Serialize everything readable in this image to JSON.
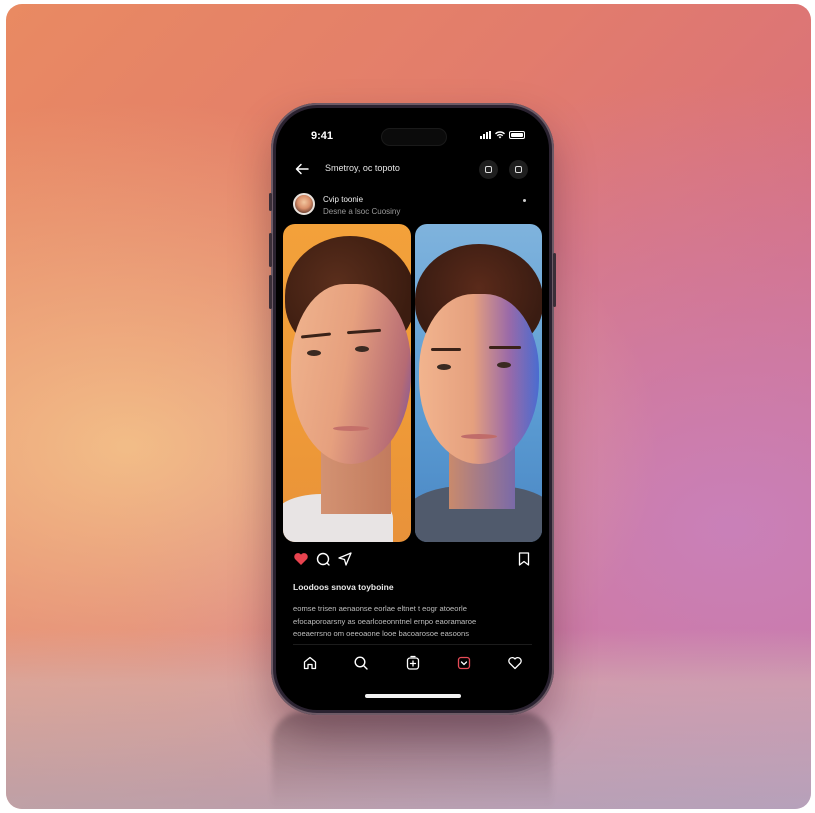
{
  "status": {
    "time": "9:41"
  },
  "topbar": {
    "title": "Smetroy, oc topoto",
    "back_icon": "arrow-left-icon",
    "action_icons": [
      "square-icon",
      "square-icon"
    ]
  },
  "post": {
    "author_name": "Cvip toonie",
    "author_subtitle": "Desne a lsoc Cuosiny",
    "caption_title": "Loodoos snova toyboine",
    "caption_lines": [
      "eomse trisen aenaonse eorlae eltnet t eogr atoeorle",
      "efocaporoarsny as oearlcoeonntnel ernpo eaoramaroe",
      "eoeaerrsno om oeeoaone looe bacoarosoe easoons"
    ],
    "photos": [
      {
        "name": "portrait-warm",
        "accent": "#f2a03a"
      },
      {
        "name": "portrait-cool",
        "accent": "#5a9bd2"
      }
    ]
  },
  "tabs": [
    {
      "name": "home",
      "icon": "home-icon"
    },
    {
      "name": "search",
      "icon": "search-icon"
    },
    {
      "name": "create",
      "icon": "add-post-icon"
    },
    {
      "name": "reels",
      "icon": "reels-icon",
      "color": "#e64b57"
    },
    {
      "name": "activity",
      "icon": "heart-icon"
    }
  ],
  "colors": {
    "like": "#e8434f",
    "screen": "#000000"
  }
}
